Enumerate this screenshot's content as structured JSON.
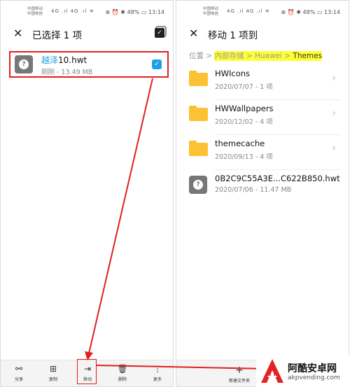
{
  "status_bar": {
    "carrier_1": "中国移动",
    "carrier_2": "中国电信",
    "signal": "4G .ıl 4G .ıl ≋",
    "right": "⊗ ⏰ ✱ 48% ▭ 13:14"
  },
  "left_screen": {
    "title": "已选择 1 项",
    "file": {
      "name_highlight": "越泽",
      "name_rest": "10.hwt",
      "meta": "刚刚 - 13.49 MB",
      "checked": true
    },
    "bottom_bar": [
      {
        "icon": "share-icon",
        "glyph": "⚯",
        "label": "分享"
      },
      {
        "icon": "copy-icon",
        "glyph": "⊞",
        "label": "复制"
      },
      {
        "icon": "move-icon",
        "glyph": "⇥",
        "label": "移动"
      },
      {
        "icon": "delete-icon",
        "glyph": "🗑",
        "label": "删除"
      },
      {
        "icon": "more-icon",
        "glyph": "⋮",
        "label": "更多"
      }
    ]
  },
  "right_screen": {
    "title": "移动 1 项到",
    "breadcrumb": {
      "prefix": "位置",
      "items": [
        "内部存储",
        "Huawei",
        "Themes"
      ]
    },
    "items": [
      {
        "type": "folder",
        "name": "HWIcons",
        "meta": "2020/07/07 - 1 项"
      },
      {
        "type": "folder",
        "name": "HWWallpapers",
        "meta": "2020/12/02 - 4 项"
      },
      {
        "type": "folder",
        "name": "themecache",
        "meta": "2020/09/13 - 4 项"
      },
      {
        "type": "file",
        "name": "0B2C9C55A3E...C622B850.hwt",
        "meta": "2020/07/06 - 11.47 MB"
      }
    ],
    "new_folder_label": "新建文件夹",
    "new_folder_glyph": "+"
  },
  "watermark": {
    "cn": "阿酷安卓网",
    "en": "akpvending.com"
  },
  "annotation_color": "#e02020"
}
